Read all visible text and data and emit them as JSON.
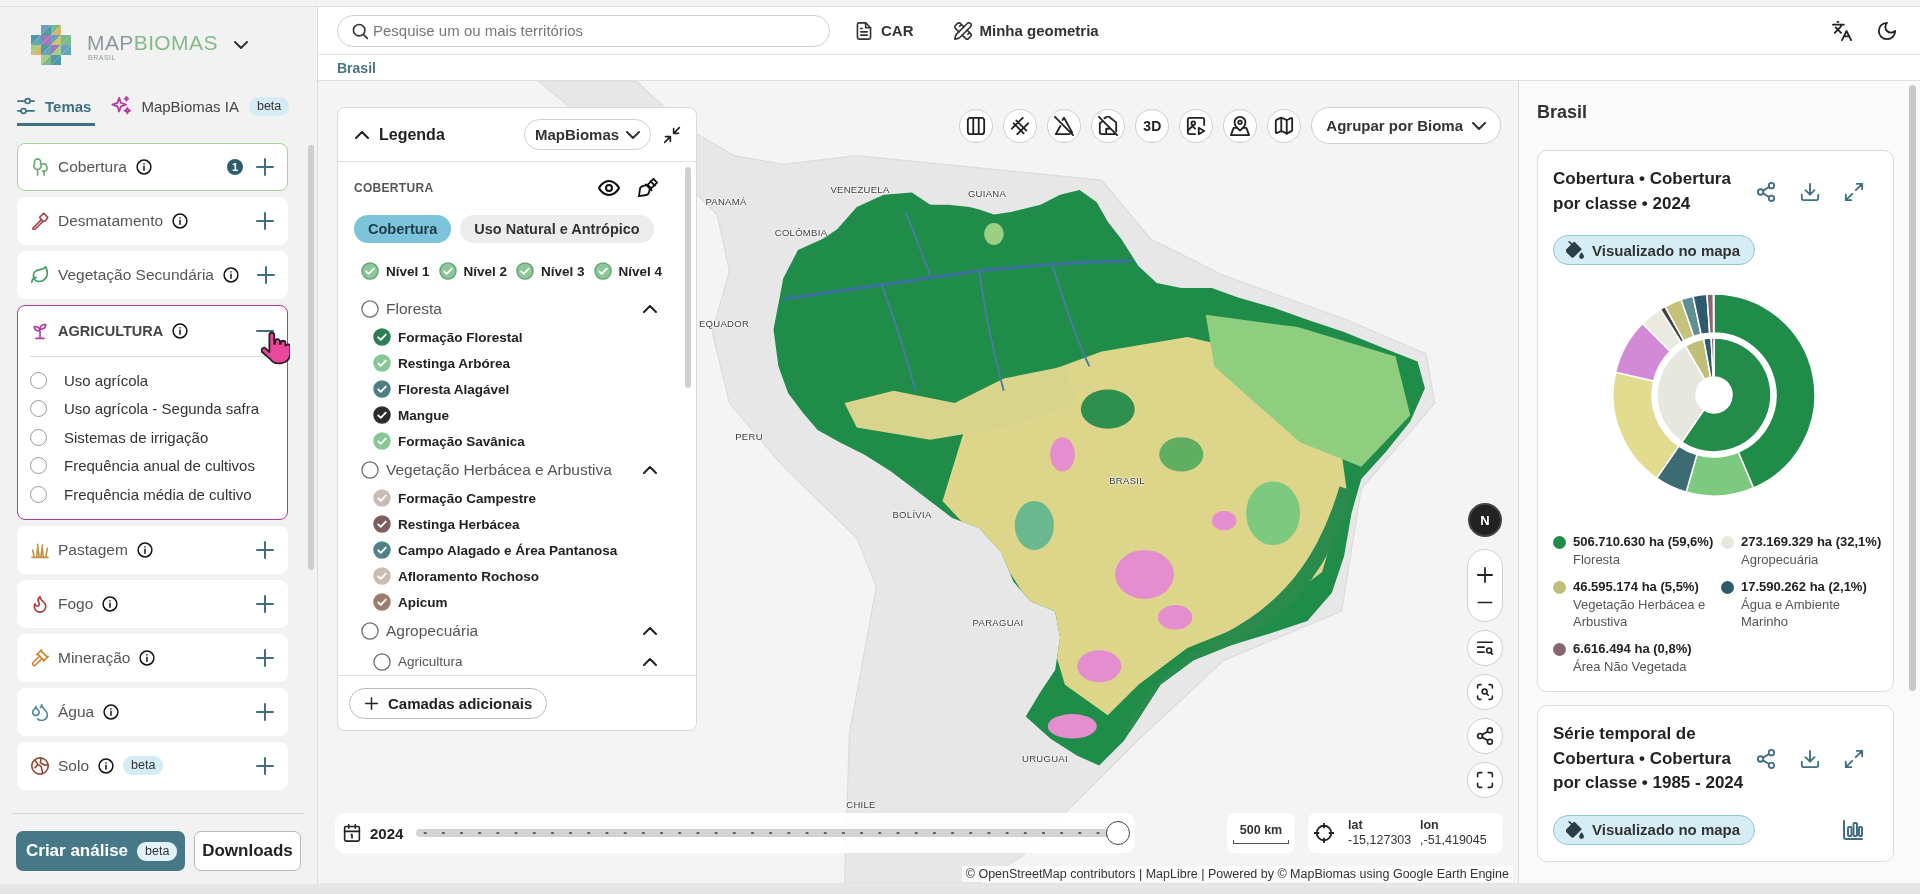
{
  "brand": {
    "wordmark_parts": [
      "MAP",
      "BIOMAS"
    ],
    "subtitle": "BRASIL"
  },
  "sidebar_tabs": [
    {
      "label": "Temas",
      "selected": true
    },
    {
      "label": "MapBiomas IA",
      "selected": false,
      "badge": "beta"
    }
  ],
  "themes": [
    {
      "label": "Cobertura",
      "count": "1",
      "active": true,
      "expanded": false
    },
    {
      "label": "Desmatamento",
      "active": false,
      "expanded": false
    },
    {
      "label": "Vegetação Secundária",
      "active": false,
      "expanded": false
    },
    {
      "label": "AGRICULTURA",
      "active": false,
      "expanded": true,
      "layers": [
        {
          "label": "Uso agrícola",
          "selected": false
        },
        {
          "label": "Uso agrícola - Segunda safra",
          "selected": false
        },
        {
          "label": "Sistemas de irrigação",
          "selected": false
        },
        {
          "label": "Frequência anual de cultivos",
          "selected": false
        },
        {
          "label": "Frequência média de cultivo",
          "selected": false
        }
      ]
    },
    {
      "label": "Pastagem",
      "active": false,
      "expanded": false
    },
    {
      "label": "Fogo",
      "active": false,
      "expanded": false
    },
    {
      "label": "Mineração",
      "active": false,
      "expanded": false
    },
    {
      "label": "Água",
      "active": false,
      "expanded": false
    },
    {
      "label": "Solo",
      "badge": "beta",
      "active": false,
      "expanded": false
    }
  ],
  "sidebar_actions": [
    {
      "kind": "primary",
      "label": "Criar análise",
      "badge": "beta"
    },
    {
      "kind": "secondary",
      "label": "Downloads"
    }
  ],
  "search": {
    "placeholder": "Pesquise um ou mais territórios"
  },
  "top_links": [
    {
      "label": "CAR"
    },
    {
      "label": "Minha geometria"
    }
  ],
  "breadcrumb": "Brasil",
  "legend": {
    "title": "Legenda",
    "expanded": true,
    "source": "MapBiomas",
    "section": "COBERTURA",
    "tabs": [
      {
        "label": "Cobertura",
        "selected": true
      },
      {
        "label": "Uso Natural e Antrópico",
        "selected": false
      }
    ],
    "levels": [
      {
        "label": "Nível 1",
        "checked": true
      },
      {
        "label": "Nível 2",
        "checked": true
      },
      {
        "label": "Nível 3",
        "checked": true
      },
      {
        "label": "Nível 4",
        "checked": true
      }
    ],
    "classes": [
      {
        "label": "Floresta",
        "checked": false,
        "expanded": true,
        "children": [
          {
            "label": "Formação Florestal",
            "checked": true,
            "color": "#2e7d55"
          },
          {
            "label": "Restinga Arbórea",
            "checked": true,
            "color": "#86c795"
          },
          {
            "label": "Floresta Alagável",
            "checked": true,
            "color": "#4e7e82"
          },
          {
            "label": "Mangue",
            "checked": true,
            "color": "#2b2b2b"
          },
          {
            "label": "Formação Savânica",
            "checked": true,
            "color": "#86c795"
          }
        ]
      },
      {
        "label": "Vegetação Herbácea e Arbustiva",
        "checked": false,
        "expanded": true,
        "children": [
          {
            "label": "Formação Campestre",
            "checked": true,
            "color": "#c9bcb4"
          },
          {
            "label": "Restinga Herbácea",
            "checked": true,
            "color": "#7c5e5e"
          },
          {
            "label": "Campo Alagado e Área Pantanosa",
            "checked": true,
            "color": "#4f8187"
          },
          {
            "label": "Afloramento Rochoso",
            "checked": true,
            "color": "#c8bbb2"
          },
          {
            "label": "Apicum",
            "checked": true,
            "color": "#9c7c6c"
          }
        ]
      },
      {
        "label": "Agropecuária",
        "checked": false,
        "expanded": true,
        "children": [
          {
            "label": "Agricultura",
            "checked": false,
            "expanded": true
          }
        ]
      }
    ],
    "add_button": "Camadas adicionais"
  },
  "map": {
    "labels": [
      "PANAMÁ",
      "VENEZUELA",
      "GUIANA",
      "COLÔMBIA",
      "EQUADOR",
      "PERU",
      "BOLÍVIA",
      "BRASIL",
      "PARAGUAI",
      "URUGUAI",
      "CHILE"
    ],
    "toolbar_text": "3D",
    "group_by": "Agrupar por Bioma",
    "compass": "N",
    "timeline": {
      "year": "2024",
      "level": 1
    },
    "scale": "500 km",
    "coordinates": {
      "lat_label": "lat",
      "lat": "-15,127303",
      "lon_label": "lon",
      "lon": ",-51,419045"
    },
    "attribution": "© OpenStreetMap contributors | MapLibre | Powered by © MapBiomas using Google Earth Engine"
  },
  "panel": {
    "title": "Brasil",
    "cards": [
      {
        "kind": "distribution",
        "title": "Cobertura • Cobertura por classe • 2024",
        "chip": "Visualizado no mapa",
        "chart_data": {
          "type": "donut",
          "categories": [
            "Floresta",
            "Agropecuária",
            "Vegetação Herbácea e Arbustiva",
            "Água e Ambiente Marinho",
            "Área Não Vegetada"
          ],
          "values": [
            59.6,
            32.1,
            5.5,
            2.1,
            0.8
          ]
        },
        "legend": [
          {
            "value": "506.710.630 ha (59,6%)",
            "color": "#238c4a"
          },
          {
            "value": "273.169.329 ha (32,1%)",
            "color": "#e6e8e0"
          },
          {
            "value": "46.595.174 ha (5,5%)",
            "color": "#bfbf78"
          },
          {
            "value": "17.590.262 ha (2,1%)",
            "color": "#2e5a6e"
          },
          {
            "value": "6.616.494 ha (0,8%)",
            "color": "#8a6670"
          }
        ]
      },
      {
        "kind": "time_series",
        "title": "Série temporal de Cobertura • Cobertura por classe • 1985 - 2024",
        "chip": "Visualizado no mapa"
      }
    ]
  }
}
